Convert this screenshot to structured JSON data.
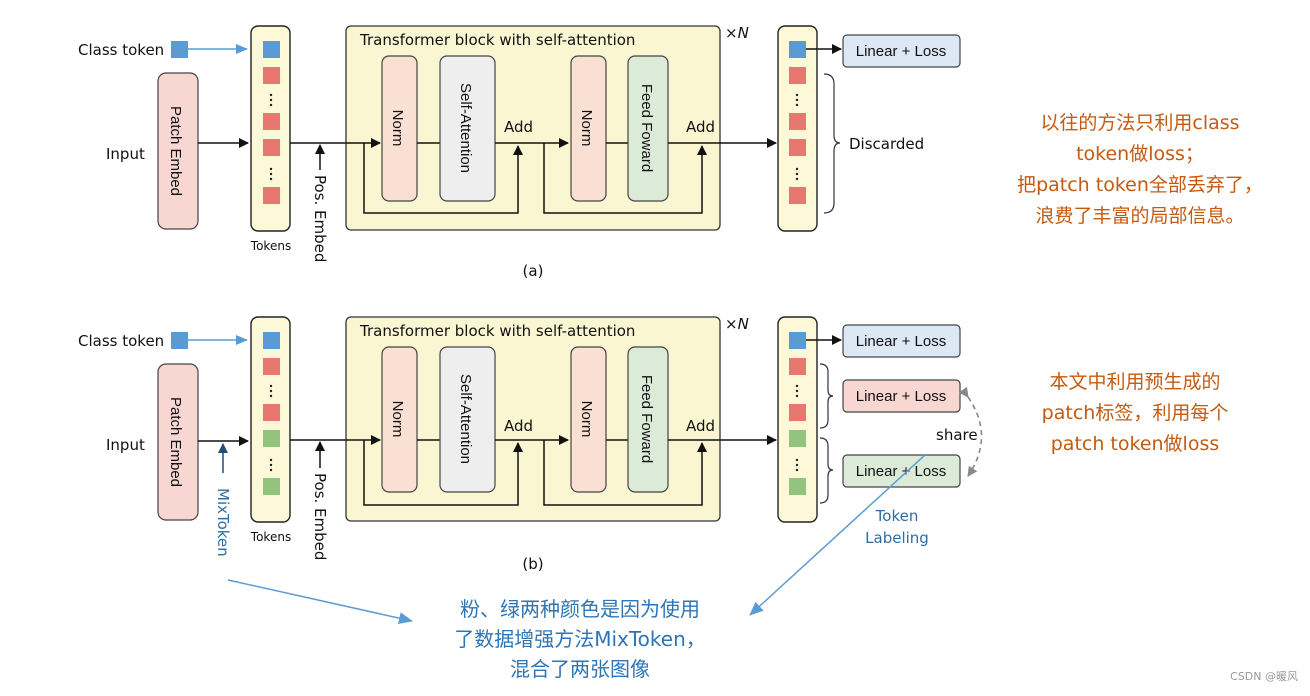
{
  "panel_a": {
    "class_token": "Class token",
    "input": "Input",
    "patch_embed": "Patch Embed",
    "tokens": "Tokens",
    "pos_embed": "Pos. Embed",
    "block_title": "Transformer block with self-attention",
    "norm1": "Norm",
    "self_attention": "Self-Attention",
    "add1": "Add",
    "norm2": "Norm",
    "feed_forward": "Feed Foward",
    "add2": "Add",
    "times_n": "×N",
    "linear_loss": "Linear + Loss",
    "discarded": "Discarded",
    "caption": "(a)",
    "token_colors": [
      "blue",
      "red",
      "dots",
      "red",
      "red",
      "dots",
      "red"
    ]
  },
  "panel_b": {
    "class_token": "Class token",
    "input": "Input",
    "patch_embed": "Patch Embed",
    "mixtoken": "MixToken",
    "tokens": "Tokens",
    "pos_embed": "Pos. Embed",
    "block_title": "Transformer block with self-attention",
    "norm1": "Norm",
    "self_attention": "Self-Attention",
    "add1": "Add",
    "norm2": "Norm",
    "feed_forward": "Feed Foward",
    "add2": "Add",
    "times_n": "×N",
    "linear_loss_cls": "Linear + Loss",
    "linear_loss_red": "Linear + Loss",
    "linear_loss_green": "Linear + Loss",
    "share": "share",
    "token_labeling_1": "Token",
    "token_labeling_2": "Labeling",
    "caption": "(b)",
    "token_colors": [
      "blue",
      "red",
      "dots",
      "red",
      "green",
      "dots",
      "green"
    ]
  },
  "notes": {
    "note_a": [
      "以往的方法只利用class",
      "token做loss；",
      "把patch token全部丢弃了，",
      "浪费了丰富的局部信息。"
    ],
    "note_b": [
      "本文中利用预生成的",
      "patch标签，利用每个",
      "patch token做loss"
    ],
    "note_mix": [
      "粉、绿两种颜色是因为使用",
      "了数据增强方法MixToken，",
      "混合了两张图像"
    ]
  },
  "watermark": "CSDN @暖风",
  "colors": {
    "token_blue": "#5b9bd5",
    "token_red": "#e8786f",
    "token_green": "#93c47d",
    "column_bg": "#fdf8d8",
    "block_bg": "#fbf6d2",
    "norm_bg": "#f9e0d3",
    "attn_bg": "#eeeeee",
    "ff_bg": "#dcead8",
    "patch_bg": "#f8d7d3",
    "loss_blue": "#dce8f5",
    "loss_red": "#f8d7d3",
    "loss_green": "#dcead8",
    "note_orange": "#c55a11",
    "note_blue": "#2e75b6"
  }
}
